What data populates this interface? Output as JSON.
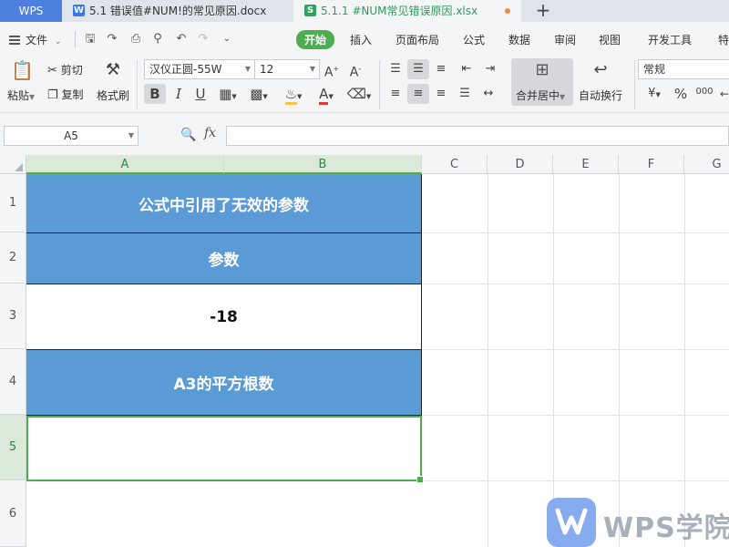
{
  "titlebar": {
    "app_tab": "WPS",
    "tabs": [
      {
        "label": "5.1 错误值#NUM!的常见原因.docx",
        "icon": "W",
        "icon_name": "writer-doc-icon",
        "icon_color": "#3b76e8"
      },
      {
        "label": "5.1.1 #NUM常见错误原因.xlsx",
        "icon": "S",
        "icon_name": "spreadsheet-icon",
        "icon_color": "#2ea35a"
      }
    ],
    "add_tab": "+"
  },
  "menubar": {
    "file": "文件",
    "items": [
      "开始",
      "插入",
      "页面布局",
      "公式",
      "数据",
      "审阅",
      "视图",
      "开发工具",
      "特"
    ],
    "active": "开始",
    "accent": "#4cae4f"
  },
  "ribbon": {
    "paste": "粘贴",
    "cut": "剪切",
    "copy": "复制",
    "format_painter": "格式刷",
    "font_name": "汉仪正圆-55W",
    "font_size": "12",
    "merge_center": "合并居中",
    "wrap_text": "自动换行",
    "number_format": "常规",
    "percent": "%",
    "thousands": "000"
  },
  "formulabar": {
    "name_box": "A5",
    "fx": "fx",
    "formula": ""
  },
  "grid": {
    "columns": [
      "A",
      "B",
      "C",
      "D",
      "E",
      "F",
      "G"
    ],
    "selected_columns": [
      "A",
      "B"
    ],
    "rows": [
      "1",
      "2",
      "3",
      "4",
      "5",
      "6"
    ],
    "selected_row": "5",
    "cells": {
      "r1": "公式中引用了无效的参数",
      "r2": "参数",
      "r3": "-18",
      "r4": "A3的平方根数",
      "r5": ""
    },
    "header_fill": "#5b9bd5"
  },
  "watermark": {
    "text": "WPS学院"
  }
}
